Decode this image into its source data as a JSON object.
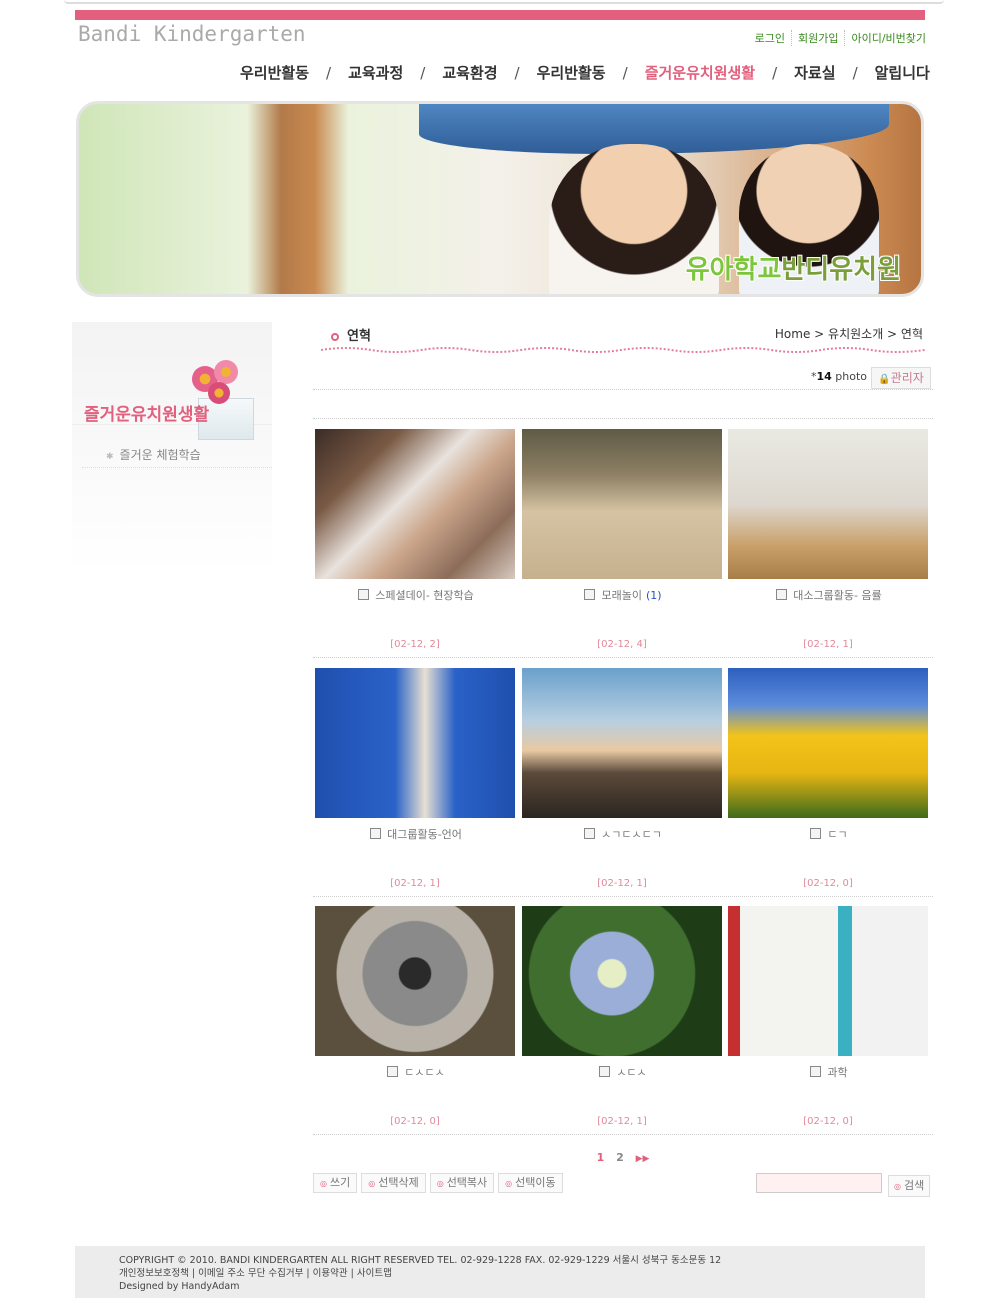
{
  "header": {
    "logo": "Bandi Kindergarten",
    "top_links": [
      "로그인",
      "회원가입",
      "아이디/비번찾기"
    ]
  },
  "nav": {
    "items": [
      {
        "label": "우리반활동",
        "active": false
      },
      {
        "label": "교육과정",
        "active": false
      },
      {
        "label": "교육환경",
        "active": false
      },
      {
        "label": "우리반활동",
        "active": false
      },
      {
        "label": "즐거운유치원생활",
        "active": true
      },
      {
        "label": "자료실",
        "active": false
      },
      {
        "label": "알립니다",
        "active": false
      }
    ],
    "separator": "/"
  },
  "banner": {
    "title_part1": "유아학교",
    "title_part2": "반디유치원"
  },
  "sidebar": {
    "title": "즐거운유치원생활",
    "items": [
      "즐거운 체험학습"
    ]
  },
  "content": {
    "section_title": "연혁",
    "breadcrumb": "Home > 유치원소개 > 연혁",
    "count_prefix": "*",
    "count_value": "14",
    "count_unit": "photo",
    "admin_label": "관리자",
    "photos": [
      {
        "title": "스페셜데이- 현장학습",
        "comments": "",
        "date": "[02-12, 2]",
        "theme": "3d"
      },
      {
        "title": "모래놀이",
        "comments": "(1)",
        "date": "[02-12, 4]",
        "theme": "sand"
      },
      {
        "title": "대소그룹활동- 음률",
        "comments": "",
        "date": "[02-12, 1]",
        "theme": "room"
      },
      {
        "title": "대그룹활동-언어",
        "comments": "",
        "date": "[02-12, 1]",
        "theme": "dolls"
      },
      {
        "title": "ㅅㄱㄷㅅㄷㄱ",
        "comments": "",
        "date": "[02-12, 1]",
        "theme": "lighthouse"
      },
      {
        "title": "ㄷㄱ",
        "comments": "",
        "date": "[02-12, 0]",
        "theme": "tulips"
      },
      {
        "title": "ㄷㅅㄷㅅ",
        "comments": "",
        "date": "[02-12, 0]",
        "theme": "koala"
      },
      {
        "title": "ㅅㄷㅅ",
        "comments": "",
        "date": "[02-12, 1]",
        "theme": "hydrangea"
      },
      {
        "title": "과학",
        "comments": "",
        "date": "[02-12, 0]",
        "theme": "science"
      }
    ],
    "pager": {
      "pages": [
        "1",
        "2"
      ],
      "current": "1",
      "next": "▶▶"
    },
    "buttons": [
      "쓰기",
      "선택삭제",
      "선택복사",
      "선택이동"
    ],
    "search_placeholder": "",
    "search_label": "검색"
  },
  "footer": {
    "copyright": "COPYRIGHT © 2010. BANDI KINDERGARTEN ALL RIGHT RESERVED TEL. 02-929-1228 FAX. 02-929-1229 서울시 성북구 동소문동 12",
    "links": [
      "개인정보보호정책",
      "이메일 주소 무단 수집거부",
      "이용약관",
      "사이트맵"
    ],
    "designed_by": "Designed by HandyAdam"
  },
  "colors": {
    "accent": "#e2607e",
    "link_green": "#3a8a1f",
    "date": "#e08a9a"
  }
}
